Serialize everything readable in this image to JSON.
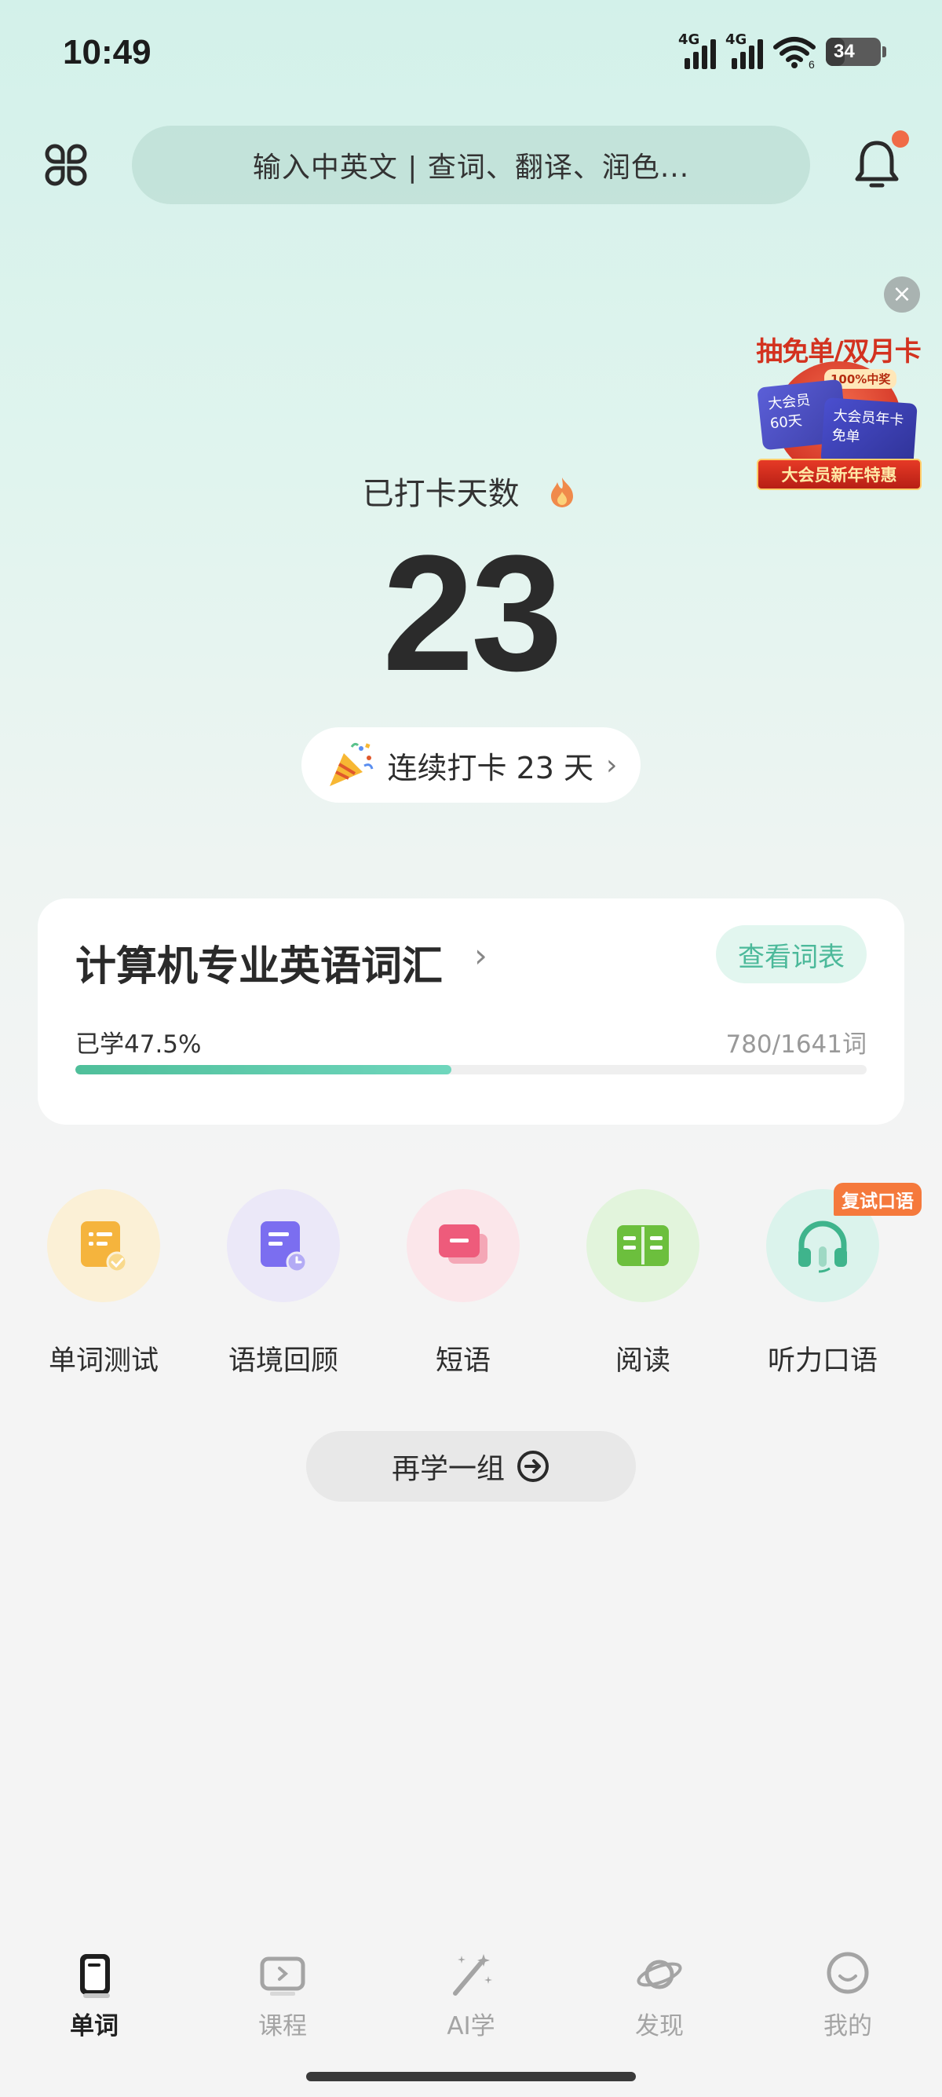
{
  "status_bar": {
    "time": "10:49",
    "network1": "4G",
    "network2": "4G",
    "wifi_sub": "6",
    "battery": "34",
    "battery_level": 0.34
  },
  "header": {
    "apps_icon": "grid-apps-icon",
    "search_placeholder": "输入中英文 | 查词、翻译、润色...",
    "bell_icon": "bell-icon"
  },
  "promo": {
    "title": "抽免单/双月卡",
    "badge": "100%中奖",
    "card1_line1": "大会员",
    "card1_line2": "60天",
    "card2_line1": "大会员年卡",
    "card2_line2": "免单",
    "banner": "大会员新年特惠",
    "close": "×"
  },
  "checkin": {
    "label": "已打卡天数",
    "count": "23",
    "streak_text": "连续打卡 23 天",
    "streak_chevron": "›"
  },
  "wordbook": {
    "title": "计算机专业英语词汇",
    "chevron": "›",
    "view_button": "查看词表",
    "progress_label": "已学47.5%",
    "progress_fraction": 0.475,
    "count": "780/1641词"
  },
  "features": [
    {
      "label": "单词测试",
      "icon": "quiz-doc-icon",
      "bg": "#fbf0d6"
    },
    {
      "label": "语境回顾",
      "icon": "context-review-icon",
      "bg": "#ebe8f8"
    },
    {
      "label": "短语",
      "icon": "phrase-chat-icon",
      "bg": "#fbe6ea"
    },
    {
      "label": "阅读",
      "icon": "open-book-icon",
      "bg": "#e2f4dc"
    },
    {
      "label": "听力口语",
      "icon": "headphones-icon",
      "bg": "#dbf3ec",
      "tag": "复试口语"
    }
  ],
  "again_button": "再学一组",
  "tabs": [
    {
      "label": "单词",
      "icon": "word-card-icon",
      "active": true
    },
    {
      "label": "课程",
      "icon": "course-play-icon",
      "active": false
    },
    {
      "label": "AI学",
      "icon": "magic-wand-icon",
      "active": false
    },
    {
      "label": "发现",
      "icon": "planet-icon",
      "active": false
    },
    {
      "label": "我的",
      "icon": "smile-face-icon",
      "active": false
    }
  ],
  "colors": {
    "accent": "#4cb99a",
    "progress_start": "#4fbf9a",
    "notification_dot": "#f06b47",
    "tag_orange": "#f5793c"
  }
}
